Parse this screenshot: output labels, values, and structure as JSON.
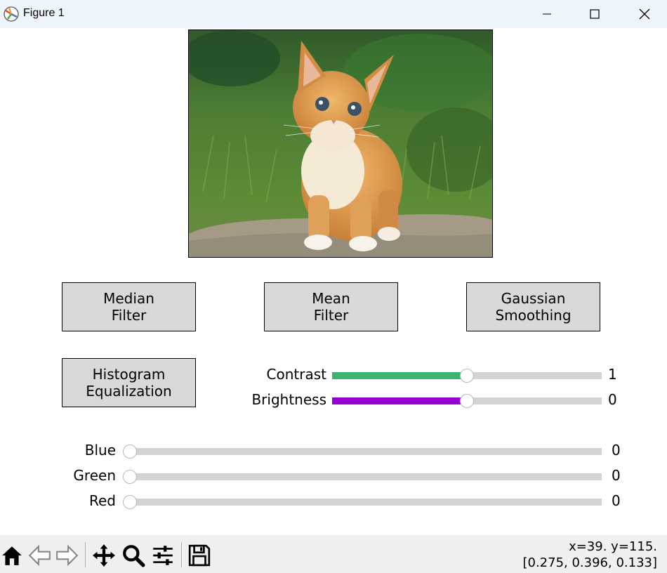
{
  "window": {
    "title": "Figure 1"
  },
  "buttons": {
    "median": [
      "Median",
      "Filter"
    ],
    "mean": [
      "Mean",
      "Filter"
    ],
    "gaussian": [
      "Gaussian",
      "Smoothing"
    ],
    "histogram": [
      "Histogram",
      "Equalization"
    ]
  },
  "sliders": {
    "contrast": {
      "label": "Contrast",
      "value": "1",
      "fraction": 0.5,
      "color": "#3cb371"
    },
    "brightness": {
      "label": "Brightness",
      "value": "0",
      "fraction": 0.5,
      "color": "#9400d3"
    },
    "blue": {
      "label": "Blue",
      "value": "0",
      "fraction": 0.0
    },
    "green": {
      "label": "Green",
      "value": "0",
      "fraction": 0.0
    },
    "red": {
      "label": "Red",
      "value": "0",
      "fraction": 0.0
    }
  },
  "toolbar": {
    "icons": [
      "home-icon",
      "back-icon",
      "forward-icon",
      "pan-icon",
      "zoom-icon",
      "configure-subplots-icon",
      "save-icon"
    ]
  },
  "status": {
    "line1": "x=39. y=115.",
    "line2": "[0.275, 0.396, 0.133]"
  },
  "colors": {
    "titlebar": "#eef4fb",
    "button_face": "#d9d9d9",
    "slider_track": "#d3d3d3"
  }
}
